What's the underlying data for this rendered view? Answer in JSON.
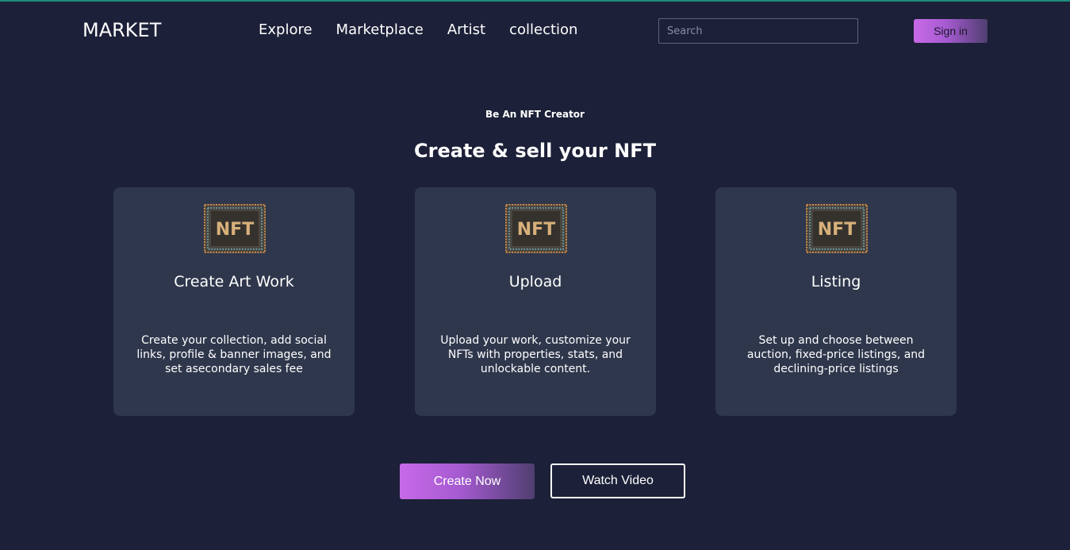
{
  "header": {
    "logo": "MARKET",
    "nav": [
      "Explore",
      "Marketplace",
      "Artist",
      "collection"
    ],
    "search_placeholder": "Search",
    "signin_label": "Sign in"
  },
  "hero": {
    "eyebrow": "Be An NFT Creator",
    "title": "Create & sell your NFT"
  },
  "cards": [
    {
      "image_text": "NFT",
      "title": "Create Art Work",
      "description": "Create your collection, add social links, profile & banner images, and set asecondary sales fee"
    },
    {
      "image_text": "NFT",
      "title": "Upload",
      "description": "Upload your work, customize your NFTs with properties, stats, and unlockable content."
    },
    {
      "image_text": "NFT",
      "title": "Listing",
      "description": "Set up and choose between auction, fixed-price listings, and declining-price listings"
    }
  ],
  "actions": {
    "primary_label": "Create Now",
    "secondary_label": "Watch Video"
  },
  "colors": {
    "background": "#1c2038",
    "card": "#2f374c",
    "accent_start": "#c86ae8",
    "accent_end": "#4f3e70"
  }
}
